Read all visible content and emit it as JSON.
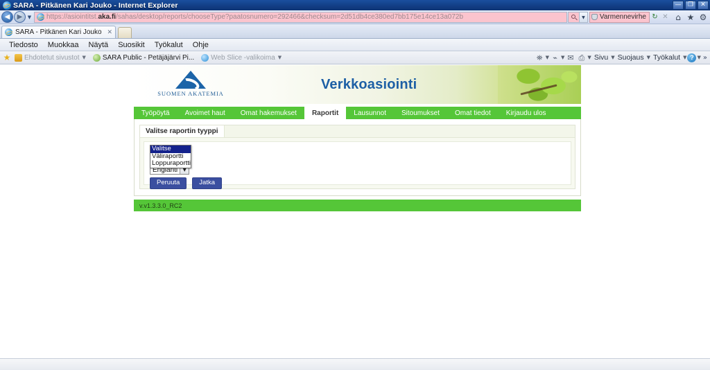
{
  "window": {
    "title": "SARA - Pitkänen Kari Jouko - Internet Explorer",
    "minimize_label": "—",
    "restore_label": "❐",
    "close_label": "✕",
    "ie_icon": "internet-explorer-icon"
  },
  "address_bar": {
    "back_label": "◀",
    "forward_label": "▶",
    "history_caret": "▼",
    "url_prefix": "https://asiointitst.",
    "url_domain": "aka.fi",
    "url_suffix": "/sahas/desktop/reports/chooseType?paatosnumero=292466&checksum=2d51db4ce380ed7bb175e14ce13a072b",
    "url_full": "https://asiointitst.aka.fi/sahas/desktop/reports/chooseType?paatosnumero=292466&checksum=2d51db4ce380ed7bb175e14ce13a072b",
    "search_caret": "▼",
    "certificate_error": "Varmennevirhe",
    "refresh_label": "↻",
    "stop_label": "✕",
    "home_label": "⌂",
    "favorites_label": "★",
    "tools_label": "⚙",
    "url_background": "#fbc4ce"
  },
  "tabs": [
    {
      "label": "SARA - Pitkänen Kari Jouko",
      "close_label": "✕",
      "active": true
    }
  ],
  "menu": {
    "items": [
      "Tiedosto",
      "Muokkaa",
      "Näytä",
      "Suosikit",
      "Työkalut",
      "Ohje"
    ]
  },
  "favorites_bar": {
    "star_label": "★",
    "items": [
      {
        "label": "Ehdotetut sivustot",
        "caret": "▼",
        "dim": true
      },
      {
        "label": "SARA Public - Petäjäjärvi Pi...",
        "caret": "",
        "dim": false
      },
      {
        "label": "Web Slice -valikoima",
        "caret": "▼",
        "dim": true
      }
    ],
    "toolbar": {
      "feeds_caret": "▼",
      "read_caret": "▼",
      "print_caret": "▼",
      "page_label": "Sivu",
      "security_label": "Suojaus",
      "tools_label": "Työkalut",
      "help_label": "?",
      "help_caret": "▼",
      "overflow_label": "»"
    }
  },
  "page": {
    "banner": {
      "logo_text": "SUOMEN AKATEMIA",
      "logo_icon": "akatemia-triangle-logo",
      "title": "Verkkoasiointi",
      "decoration": "green-leaves-photo"
    },
    "nav_tabs": [
      {
        "label": "Työpöytä",
        "active": false
      },
      {
        "label": "Avoimet haut",
        "active": false
      },
      {
        "label": "Omat hakemukset",
        "active": false
      },
      {
        "label": "Raportit",
        "active": true
      },
      {
        "label": "Lausunnot",
        "active": false
      },
      {
        "label": "Sitoumukset",
        "active": false
      },
      {
        "label": "Omat tiedot",
        "active": false
      },
      {
        "label": "Kirjaudu ulos",
        "active": false
      }
    ],
    "panel": {
      "title": "Valitse raportin tyyppi",
      "report_type_select": {
        "selected": "Valitse",
        "caret": "▼",
        "expanded": true,
        "options": [
          "Valitse",
          "Väliraportti",
          "Loppuraportti"
        ],
        "highlighted_option": "Valitse"
      },
      "language_select": {
        "selected": "Englanti",
        "caret": "▼",
        "options": [
          "Englanti"
        ]
      },
      "cancel_button": "Peruuta",
      "continue_button": "Jatka"
    },
    "footer_version": "v.v1.3.3.0_RC2",
    "accent_green": "#55c638",
    "accent_blue": "#1d5fa5",
    "button_blue": "#3b4fa0"
  }
}
